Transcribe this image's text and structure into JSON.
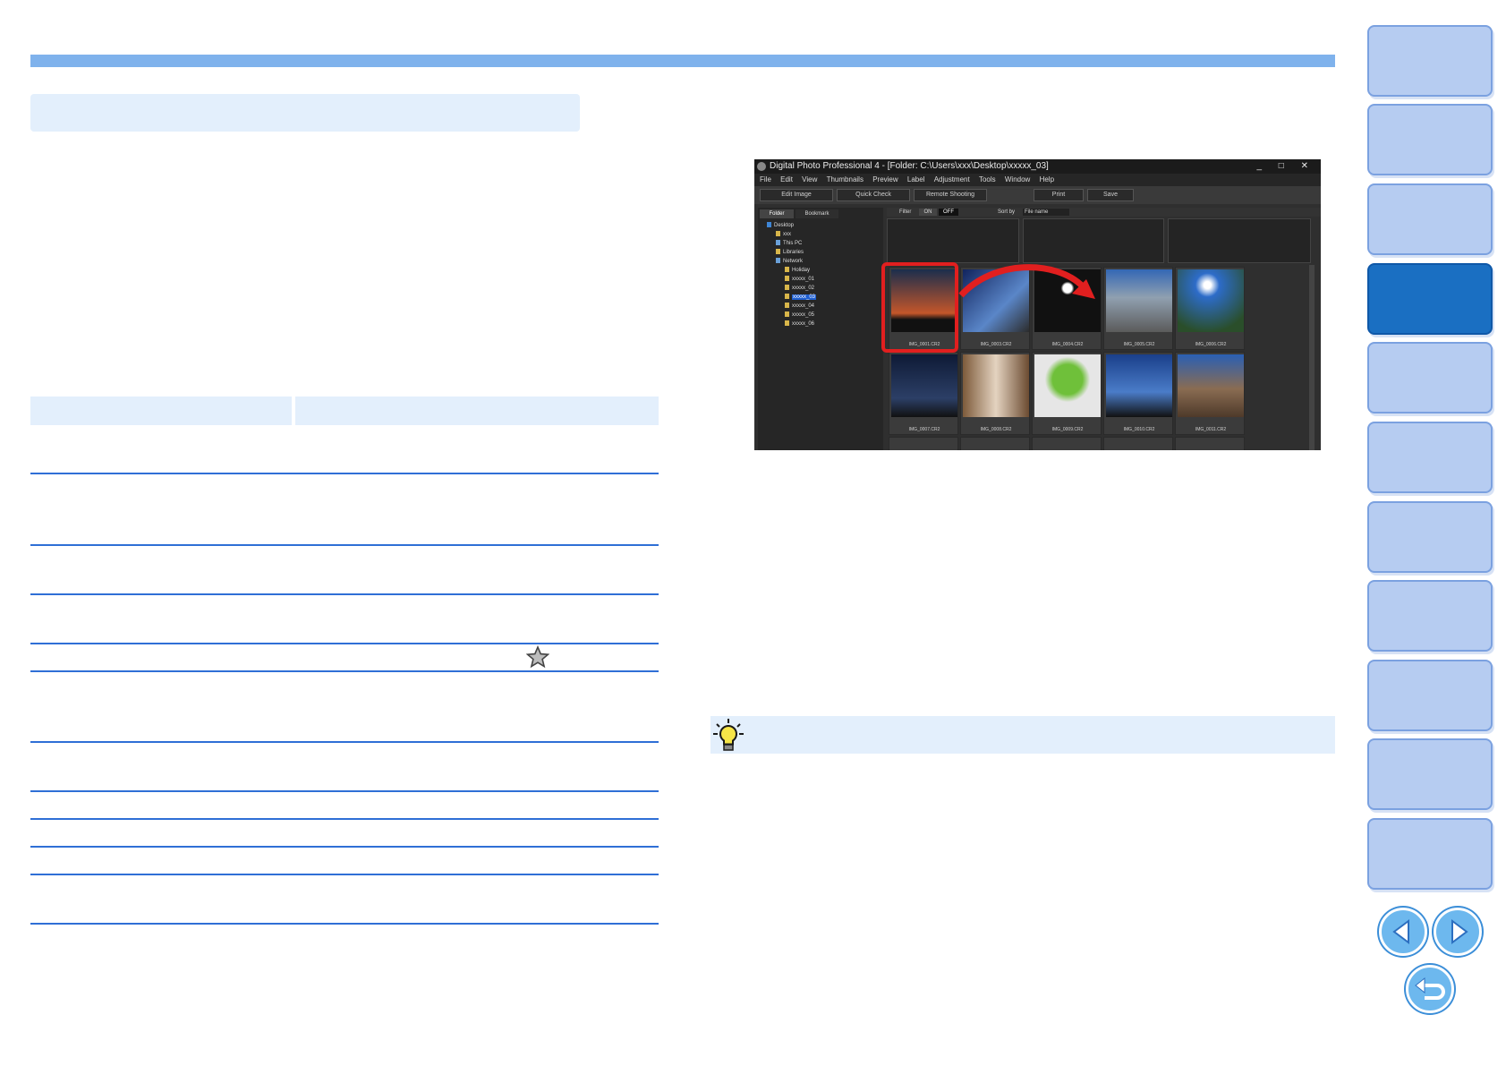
{
  "sidebar": {
    "tab_count": 11,
    "active_index": 3
  },
  "nav": {
    "prev": "previous-page",
    "next": "next-page",
    "back": "return"
  },
  "screenshot": {
    "title": "Digital Photo Professional 4 - [Folder: C:\\Users\\xxx\\Desktop\\xxxxx_03]",
    "menus": [
      "File",
      "Edit",
      "View",
      "Thumbnails",
      "Preview",
      "Label",
      "Adjustment",
      "Tools",
      "Window",
      "Help"
    ],
    "toolbar": [
      "Edit Image",
      "Quick Check",
      "Remote Shooting",
      "Print",
      "Save"
    ],
    "tabs": [
      "Folder",
      "Bookmark"
    ],
    "tree": [
      "Desktop",
      "xxx",
      "This PC",
      "Libraries",
      "Network",
      "Holiday",
      "xxxxx_01",
      "xxxxx_02",
      "xxxxx_03",
      "xxxxx_04",
      "xxxxx_05",
      "xxxxx_06"
    ],
    "selected_folder": "xxxxx_03",
    "filter_label": "Filter",
    "on_label": "ON",
    "off_label": "OFF",
    "sortby_label": "Sort by",
    "sort_value": "File name",
    "thumbs_row1": [
      "IMG_0001.CR2",
      "IMG_0003.CR2",
      "IMG_0004.CR2",
      "IMG_0005.CR2",
      "IMG_0006.CR2"
    ],
    "thumbs_row2": [
      "IMG_0007.CR2",
      "IMG_0008.CR2",
      "IMG_0009.CR2",
      "IMG_0010.CR2",
      "IMG_0011.CR2"
    ]
  }
}
